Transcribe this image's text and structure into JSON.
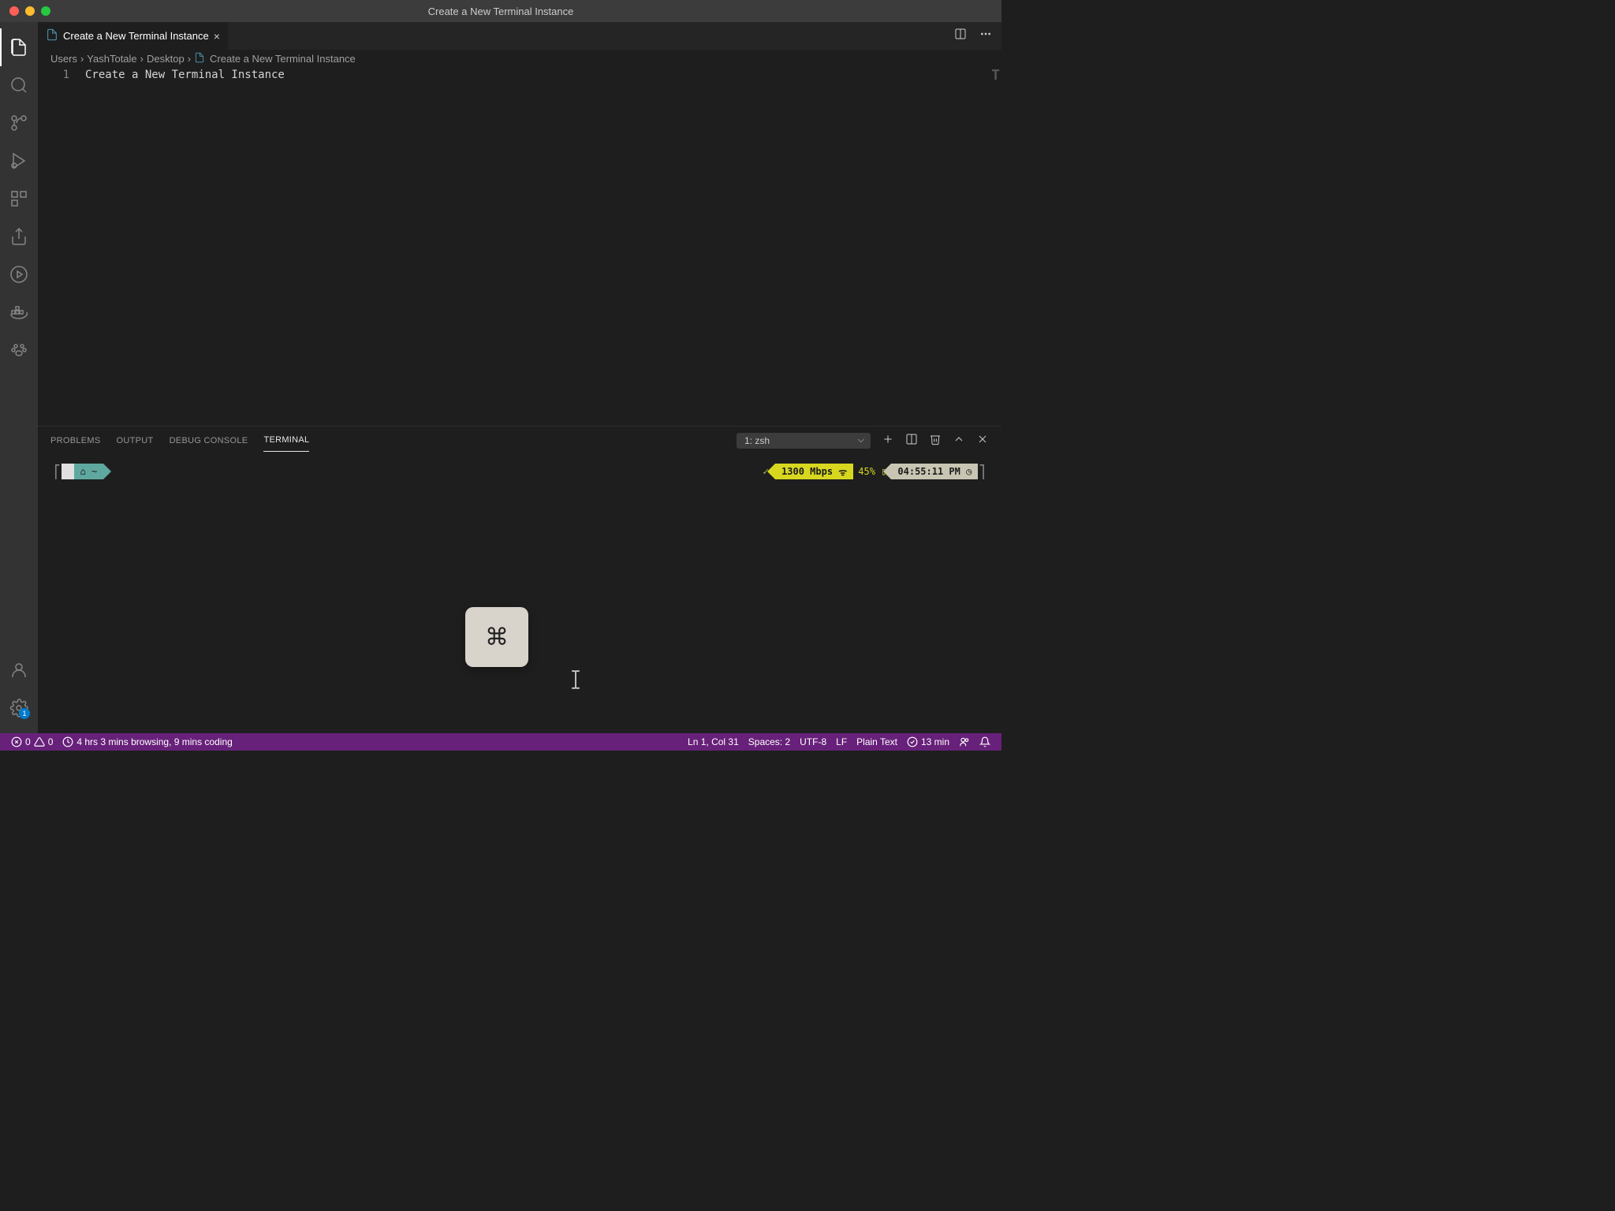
{
  "window": {
    "title": "Create a New Terminal Instance"
  },
  "tab": {
    "label": "Create a New Terminal Instance"
  },
  "breadcrumbs": {
    "parts": [
      "Users",
      "YashTotale",
      "Desktop",
      "Create a New Terminal Instance"
    ]
  },
  "editor": {
    "line_number": "1",
    "content": "Create a New Terminal Instance"
  },
  "panel": {
    "tabs": {
      "problems": "PROBLEMS",
      "output": "OUTPUT",
      "debug_console": "DEBUG CONSOLE",
      "terminal": "TERMINAL"
    },
    "terminal_selector": "1: zsh"
  },
  "terminal": {
    "check": "✓",
    "home_symbol": "~",
    "mbps": "1300 Mbps",
    "wifi_icon": "ᯤ",
    "battery": "45%",
    "battery_icon": "▯",
    "time": "04:55:11 PM",
    "clock_icon": "◷"
  },
  "key_overlay": "⌘",
  "status": {
    "errors": "0",
    "warnings": "0",
    "time_tracking": "4 hrs 3 mins browsing, 9 mins coding",
    "cursor": "Ln 1, Col 31",
    "spaces": "Spaces: 2",
    "encoding": "UTF-8",
    "eol": "LF",
    "language": "Plain Text",
    "wakatime": "13 min",
    "settings_badge": "1"
  }
}
